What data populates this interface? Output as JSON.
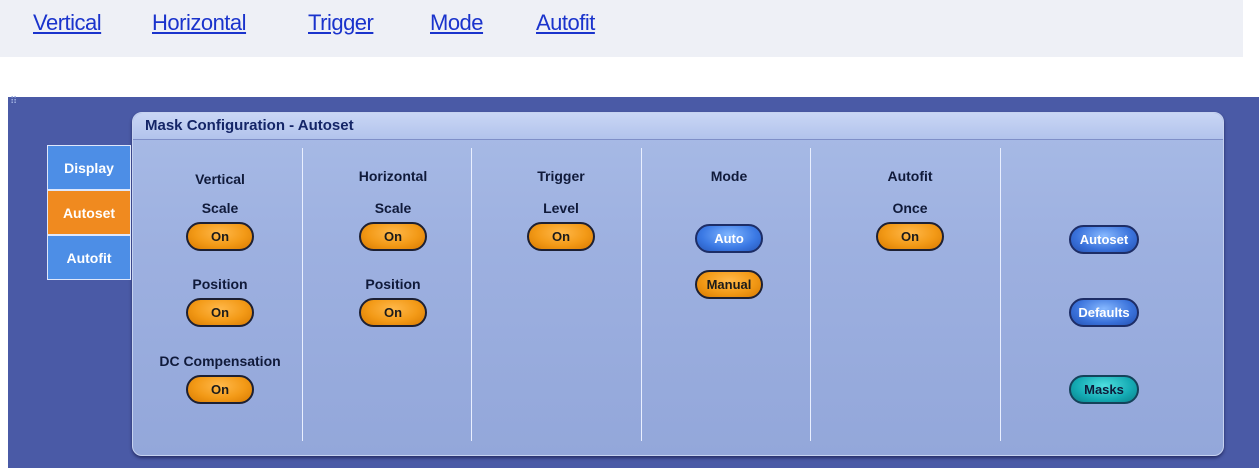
{
  "links": [
    "Vertical",
    "Horizontal",
    "Trigger",
    "Mode",
    "Autofit"
  ],
  "panel": {
    "title": "Mask Configuration - Autoset"
  },
  "tabs": [
    "Display",
    "Autoset",
    "Autofit"
  ],
  "active_tab": "Autoset",
  "columns": {
    "vertical": {
      "header": "Vertical",
      "scale_label": "Scale",
      "scale_value": "On",
      "position_label": "Position",
      "position_value": "On",
      "dc_label": "DC Compensation",
      "dc_value": "On"
    },
    "horizontal": {
      "header": "Horizontal",
      "scale_label": "Scale",
      "scale_value": "On",
      "position_label": "Position",
      "position_value": "On"
    },
    "trigger": {
      "header": "Trigger",
      "level_label": "Level",
      "level_value": "On"
    },
    "mode": {
      "header": "Mode",
      "auto": "Auto",
      "manual": "Manual",
      "selected": "Manual"
    },
    "autofit": {
      "header": "Autofit",
      "once_label": "Once",
      "once_value": "On"
    }
  },
  "side_buttons": {
    "autoset": "Autoset",
    "defaults": "Defaults",
    "masks": "Masks"
  },
  "colors": {
    "on_orange": "#f39a17",
    "button_blue": "#3b79e4",
    "masks_teal": "#14aab3",
    "screen_bg": "#4a5aa6"
  }
}
